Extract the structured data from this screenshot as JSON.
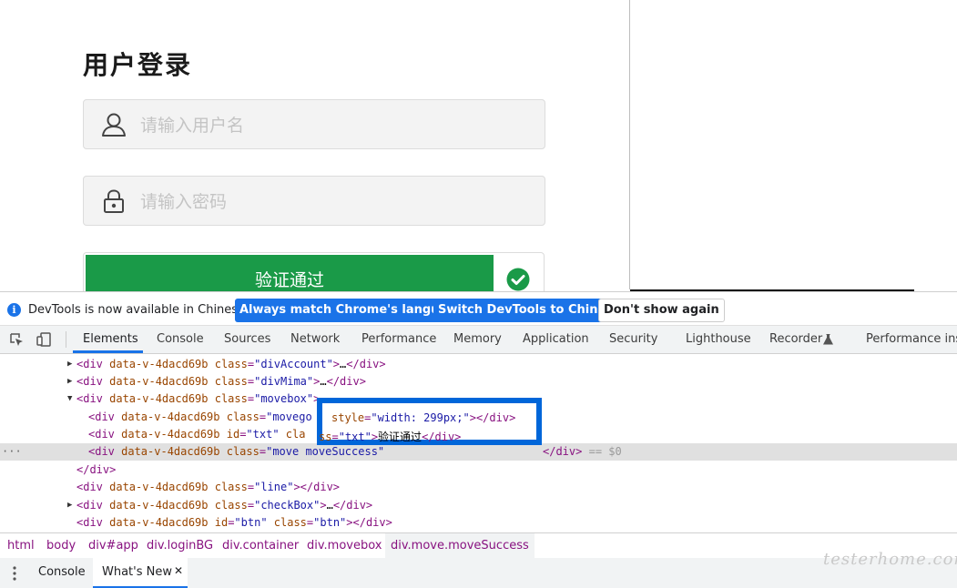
{
  "login": {
    "title": "用户登录",
    "username_placeholder": "请输入用户名",
    "password_placeholder": "请输入密码",
    "slider_text": "验证通过"
  },
  "devtools": {
    "infobar": {
      "message": "DevTools is now available in Chinese!",
      "btn_match": "Always match Chrome's language",
      "btn_switch": "Switch DevTools to Chinese",
      "btn_dismiss": "Don't show again"
    },
    "tabs": [
      "Elements",
      "Console",
      "Sources",
      "Network",
      "Performance",
      "Memory",
      "Application",
      "Security",
      "Lighthouse",
      "Recorder",
      "Performance insi"
    ],
    "dom": {
      "l1_attr1": "data-v-4dacd69b",
      "l1_class": "\"divAccount\"",
      "l2_attr1": "data-v-4dacd69b",
      "l2_class": "\"divMima\"",
      "l3_attr1": "data-v-4dacd69b",
      "l3_class": "\"movebox\"",
      "l4_attr1": "data-v-4dacd69b",
      "l4_class": "\"movego",
      "l5_attr1": "data-v-4dacd69b",
      "l5_id": "\"txt\"",
      "l5_class": "cla",
      "l6_attr1": "data-v-4dacd69b",
      "l6_class": "\"move moveSuccess\"",
      "l6_eq": "== $0",
      "l8_attr1": "data-v-4dacd69b",
      "l8_class": "\"line\"",
      "l9_attr1": "data-v-4dacd69b",
      "l9_class": "\"checkBox\"",
      "l10_attr1": "data-v-4dacd69b",
      "l10_id": "\"btn\"",
      "l10_class": "\"btn\"",
      "hb_style": "\"width: 299px;\"",
      "hb_txt_class": "\"txt\"",
      "hb_text": "验证通过"
    },
    "breadcrumbs": [
      "html",
      "body",
      "div#app",
      "div.loginBG",
      "div.container",
      "div.movebox",
      "div.move.moveSuccess"
    ],
    "drawer": {
      "console": "Console",
      "whats_new": "What's New",
      "close": "✕"
    }
  },
  "watermark": "testerhome.com",
  "colors": {
    "accent": "#1a73e8",
    "success": "#1a9a48",
    "highlight": "#0066d9"
  }
}
